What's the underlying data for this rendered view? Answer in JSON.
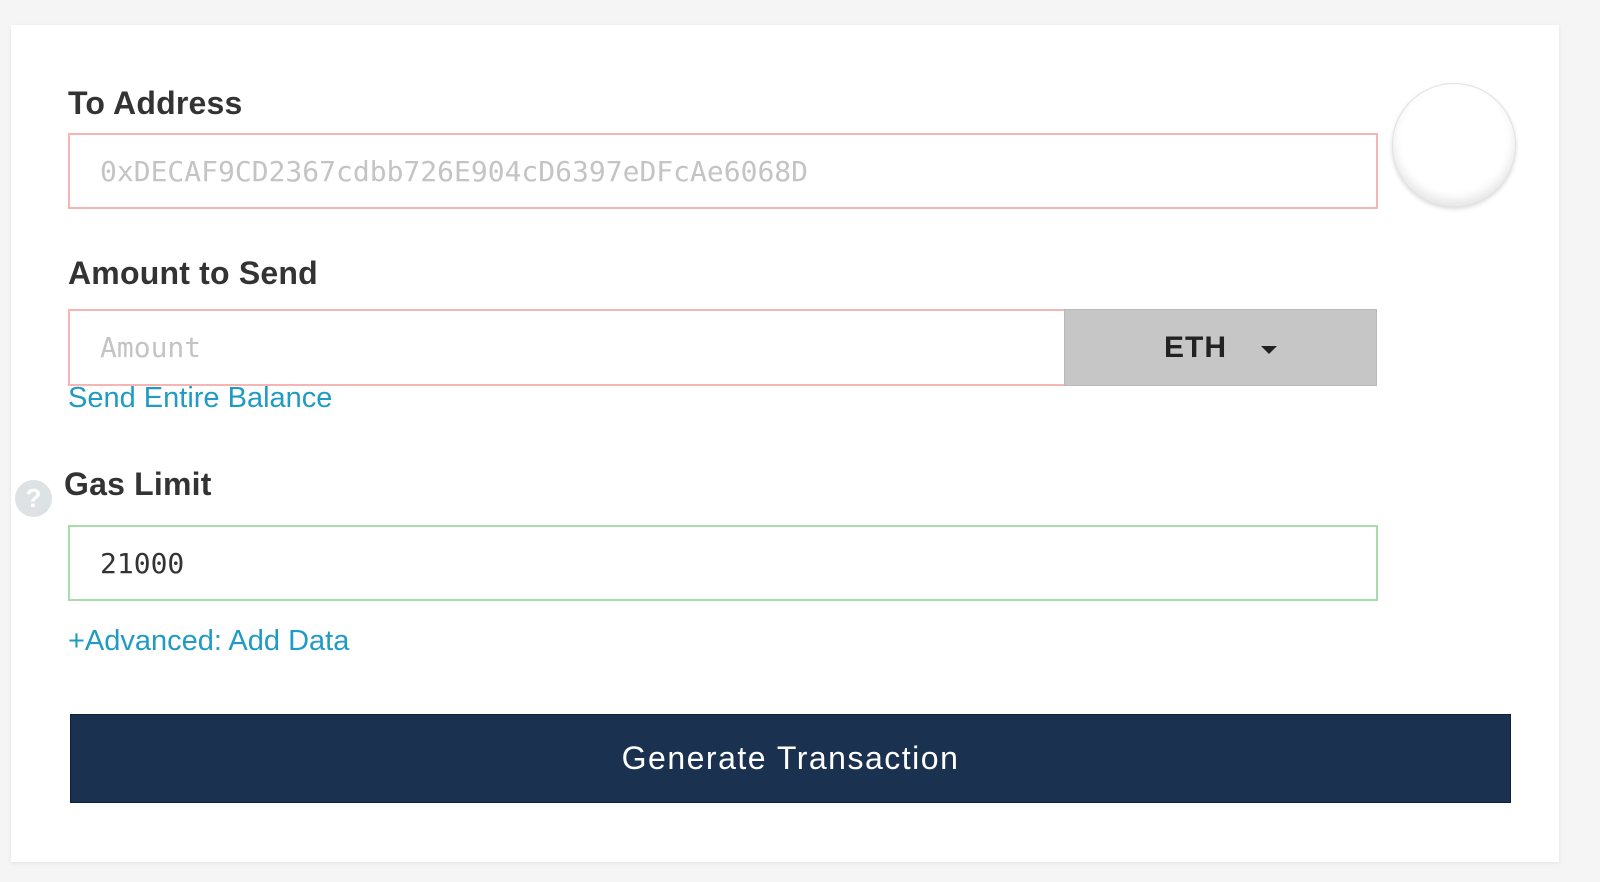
{
  "form": {
    "to_address": {
      "label": "To Address",
      "placeholder": "0xDECAF9CD2367cdbb726E904cD6397eDFcAe6068D",
      "value": ""
    },
    "amount": {
      "label": "Amount to Send",
      "placeholder": "Amount",
      "value": "",
      "unit": "ETH",
      "send_entire_balance": "Send Entire Balance"
    },
    "gas_limit": {
      "label": "Gas Limit",
      "value": "21000",
      "help_glyph": "?"
    },
    "advanced_link": "+Advanced: Add Data",
    "generate_button": "Generate Transaction"
  },
  "icons": {
    "identicon": "identicon-placeholder",
    "help": "question-circle-icon",
    "dropdown": "chevron-down-icon"
  },
  "colors": {
    "invalid_border": "#f5b5b5",
    "valid_border": "#a8dcab",
    "link": "#1f9bc4",
    "button_bg": "#1b3150",
    "select_bg": "#c6c6c6"
  }
}
